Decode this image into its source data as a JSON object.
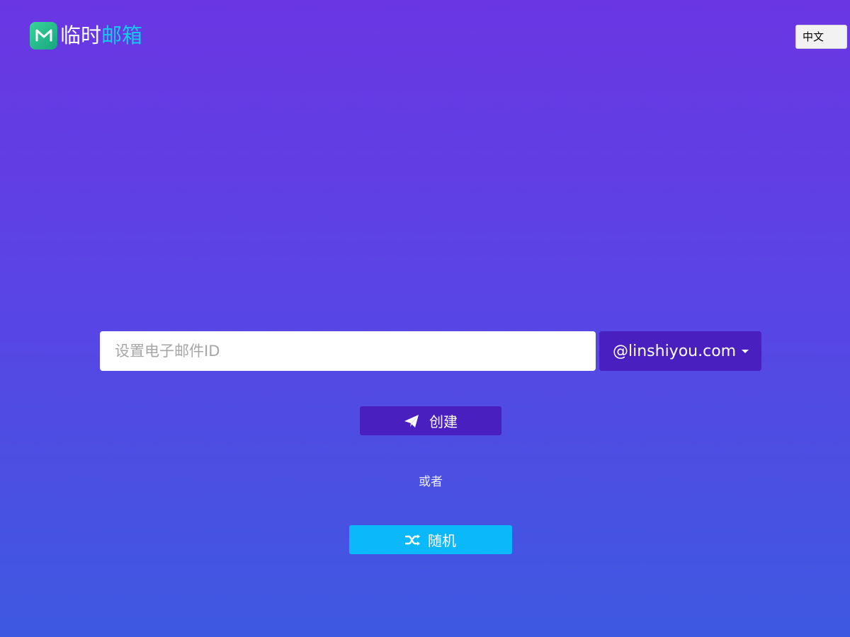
{
  "header": {
    "logo_icon": "envelope-m-logo",
    "logo_text_part1": "临时",
    "logo_text_part2": "邮箱",
    "language_selected": "中文"
  },
  "form": {
    "email_placeholder": "设置电子邮件ID",
    "email_value": "",
    "domain_selected": "@linshiyou.com",
    "domain_caret_icon": "caret-down-icon",
    "create_label": "创建",
    "create_icon": "paper-plane-icon",
    "or_text": "或者",
    "random_label": "随机",
    "random_icon": "shuffle-icon"
  },
  "colors": {
    "background_top": "#6a36e3",
    "background_bottom": "#3e59e1",
    "primary_button": "#4a1fc0",
    "random_button": "#0bb9fb",
    "logo_green": "#22b98a",
    "logo_accent_text": "#18c8ef"
  }
}
